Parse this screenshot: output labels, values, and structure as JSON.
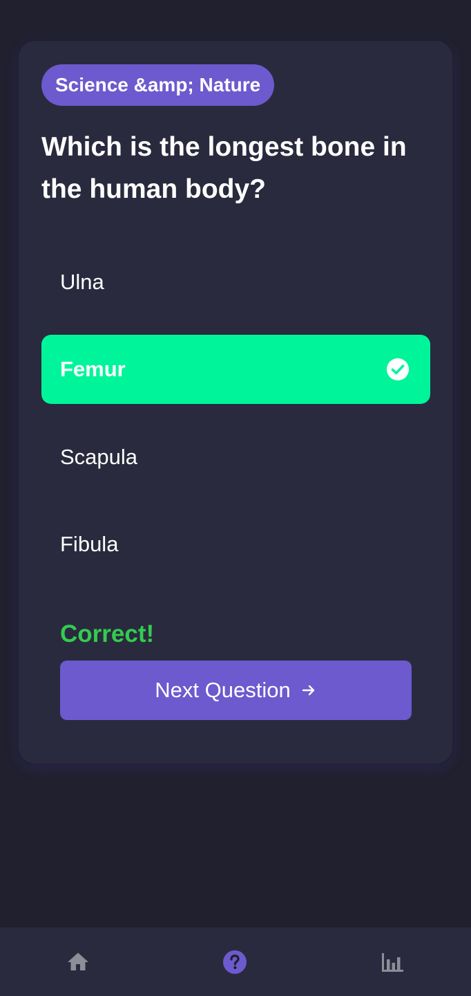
{
  "quiz": {
    "category": "Science &amp; Nature",
    "question": "Which is the longest bone in the human body?",
    "options": [
      {
        "label": "Ulna",
        "state": "default"
      },
      {
        "label": "Femur",
        "state": "correct"
      },
      {
        "label": "Scapula",
        "state": "default"
      },
      {
        "label": "Fibula",
        "state": "default"
      }
    ],
    "feedback": "Correct!",
    "next_label": "Next Question"
  },
  "colors": {
    "background": "#20202f",
    "card": "#2a2a3e",
    "accent": "#6c5ace",
    "correct": "#00f59b",
    "feedback": "#33cc4f",
    "nav_inactive": "#8e8e99"
  },
  "nav": {
    "items": [
      {
        "icon": "home-icon",
        "active": false
      },
      {
        "icon": "quiz-question-icon",
        "active": true
      },
      {
        "icon": "stats-chart-icon",
        "active": false
      }
    ]
  }
}
